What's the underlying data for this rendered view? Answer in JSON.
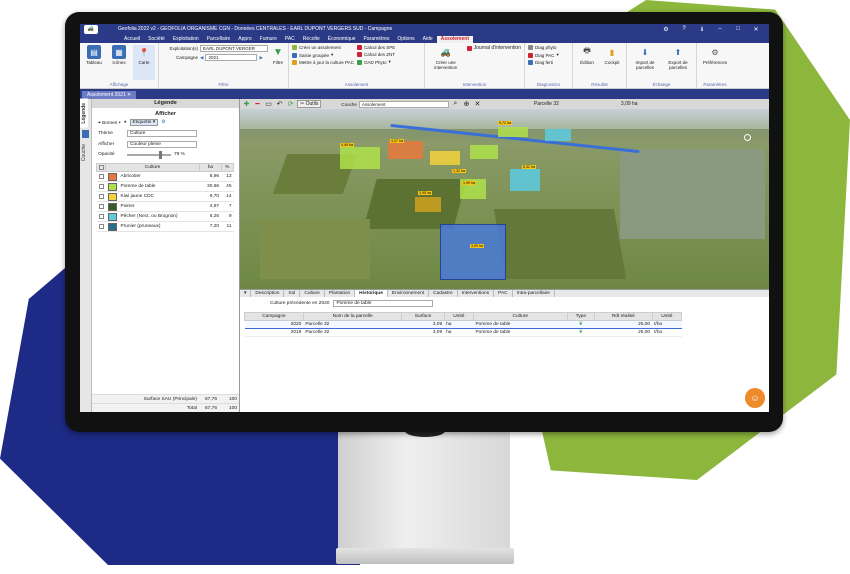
{
  "window": {
    "title": "Geofolia 2022 v2 - GEOFOLIA ORGANISME CGN - Données CENTRALES - EARL DUPONT VERGERS SUD - Campagne",
    "logo": "tractor-logo"
  },
  "menu": [
    "Accueil",
    "Société",
    "Exploitation",
    "Parcellaire",
    "Appro",
    "Fumure",
    "PAC",
    "Récolte",
    "Économique",
    "Paramètres",
    "Options",
    "Aide",
    "Assolement"
  ],
  "menu_active": "Assolement",
  "ribbon": {
    "affichage": {
      "caption": "Affichage",
      "buttons": [
        "Tableau",
        "Icônes",
        "Carte"
      ]
    },
    "filtre": {
      "caption": "Filtre",
      "exploitation_label": "Exploitation(s)",
      "exploitation_value": "EARL DUPONT VERGER",
      "campagne_label": "Campagne",
      "campagne_value": "2021",
      "filtre_button": "Filtre"
    },
    "assolement": {
      "caption": "Assolement",
      "items": [
        "Créer un assolement",
        "Saisie groupée",
        "Mettre à jour la culture PAC",
        "Calcul des SPE",
        "Calcul des ZNT",
        "OAD Phyto"
      ]
    },
    "intervention": {
      "caption": "Intervention",
      "create": "Créer une intervention",
      "journal": "Journal d'intervention"
    },
    "diagnostics": {
      "caption": "Diagnostics",
      "items": [
        "Diag phyto",
        "Diag PAC",
        "Diag ferti"
      ]
    },
    "resultat": {
      "caption": "Résultat",
      "items": [
        "Édition",
        "Cockpit"
      ]
    },
    "echange": {
      "caption": "Échange",
      "items": [
        "Import de parcelles",
        "Export de parcelles"
      ]
    },
    "parametres": {
      "caption": "Paramètres",
      "items": [
        "Préférences"
      ]
    }
  },
  "doc_tab": "Assolement 2021",
  "side_tabs": [
    "Légende",
    "Couche"
  ],
  "legend": {
    "header": "Légende",
    "afficher": "Afficher",
    "bornes": "Bornes",
    "etiquette": "Etiquette",
    "theme_label": "Thème",
    "theme_value": "Culture",
    "afficher_label": "Afficher",
    "afficher_value": "Couleur pleine",
    "opacite_label": "Opacité",
    "opacite_value": "79 %",
    "opacity_fraction": 0.79,
    "columns": [
      "Culture",
      "ha",
      "%"
    ],
    "rows": [
      {
        "name": "Abricotier",
        "ha": "8,96",
        "pct": "13",
        "color": "#e8783c"
      },
      {
        "name": "Pomme de table",
        "ha": "30,66",
        "pct": "45",
        "color": "#aee04a"
      },
      {
        "name": "Kiwi jaune CDC",
        "ha": "9,70",
        "pct": "14",
        "color": "#f4d23c"
      },
      {
        "name": "Poirier",
        "ha": "4,97",
        "pct": "7",
        "color": "#3c5a28"
      },
      {
        "name": "Pêcher (Nect. ou Brugnon)",
        "ha": "6,26",
        "pct": "9",
        "color": "#5acbe0"
      },
      {
        "name": "Prunier (pruneaux)",
        "ha": "7,20",
        "pct": "11",
        "color": "#2a6e8a"
      }
    ],
    "footer": [
      {
        "label": "Surface SAU (Principale)",
        "ha": "67,76",
        "pct": "100"
      },
      {
        "label": "Total",
        "ha": "67,76",
        "pct": "100"
      }
    ]
  },
  "map_toolbar": {
    "outils": "Outils",
    "couche": "Couche",
    "couche_value": "Assolement",
    "parcel_title": "Parcelle 32",
    "parcel_ha": "3,09 ha"
  },
  "map_labels": [
    {
      "t": "4,49 ha"
    },
    {
      "t": "4,37 ha"
    },
    {
      "t": "9,72 ha"
    },
    {
      "t": "1,32 ha"
    },
    {
      "t": "3,95 ha"
    },
    {
      "t": "5,32 ha"
    },
    {
      "t": "1,99 ha"
    },
    {
      "t": "3,09 ha"
    }
  ],
  "detail_tabs": [
    "Description",
    "Sol",
    "Culture",
    "Plantation",
    "Historique",
    "Environnement",
    "Cadastre",
    "Interventions",
    "PAC",
    "Intra-parcellaire"
  ],
  "detail_active": "Historique",
  "history": {
    "prev_label": "Culture précédente en 2020",
    "prev_value": "Pomme de table",
    "columns": [
      "Campagne",
      "Nom de la parcelle",
      "Surface",
      "Unité",
      "Culture",
      "Type",
      "Rdt réalisé",
      "Unité"
    ],
    "rows": [
      {
        "campagne": "2020",
        "parcelle": "Parcelle 32",
        "surface": "3,09",
        "unite": "ha",
        "culture": "Pomme de table",
        "rdt": "25,00",
        "rdt_unite": "t/ha"
      },
      {
        "campagne": "2019",
        "parcelle": "Parcelle 32",
        "surface": "3,09",
        "unite": "ha",
        "culture": "Pomme de table",
        "rdt": "25,00",
        "rdt_unite": "t/ha"
      }
    ]
  },
  "colors": {
    "brand": "#2b3a86",
    "accent": "#8cb63c",
    "help": "#ef8a2a"
  }
}
